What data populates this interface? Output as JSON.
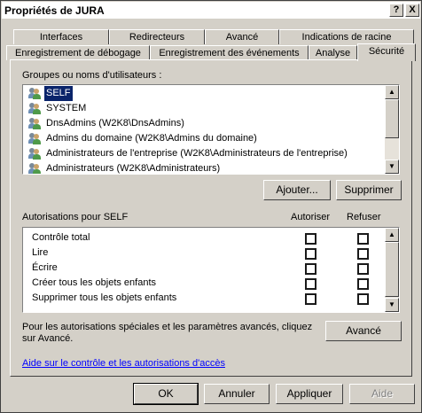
{
  "title": "Propriétés de JURA",
  "titlebar_buttons": {
    "help": "?",
    "close": "X"
  },
  "tabs_row1": [
    "Interfaces",
    "Redirecteurs",
    "Avancé",
    "Indications de racine"
  ],
  "tabs_row2": [
    "Enregistrement de débogage",
    "Enregistrement des événements",
    "Analyse",
    "Sécurité"
  ],
  "active_tab": "Sécurité",
  "groups_label": "Groupes ou noms d'utilisateurs :",
  "users": [
    {
      "name": "SELF",
      "selected": true
    },
    {
      "name": "SYSTEM"
    },
    {
      "name": "DnsAdmins (W2K8\\DnsAdmins)"
    },
    {
      "name": "Admins du domaine (W2K8\\Admins du domaine)"
    },
    {
      "name": "Administrateurs de l'entreprise (W2K8\\Administrateurs de l'entreprise)"
    },
    {
      "name": "Administrateurs (W2K8\\Administrateurs)"
    }
  ],
  "buttons": {
    "add": "Ajouter...",
    "remove": "Supprimer",
    "advanced": "Avancé",
    "ok": "OK",
    "cancel": "Annuler",
    "apply": "Appliquer",
    "help": "Aide"
  },
  "permissions_label": "Autorisations pour SELF",
  "col_allow": "Autoriser",
  "col_deny": "Refuser",
  "permissions": [
    {
      "name": "Contrôle total",
      "allow": false,
      "deny": false
    },
    {
      "name": "Lire",
      "allow": false,
      "deny": false
    },
    {
      "name": "Écrire",
      "allow": false,
      "deny": false
    },
    {
      "name": "Créer tous les objets enfants",
      "allow": false,
      "deny": false
    },
    {
      "name": "Supprimer tous les objets enfants",
      "allow": false,
      "deny": false
    }
  ],
  "special_text_1": "Pour les autorisations spéciales et les paramètres avancés, cliquez",
  "special_text_2": "sur Avancé.",
  "help_link": "Aide sur le contrôle et les autorisations d'accès"
}
